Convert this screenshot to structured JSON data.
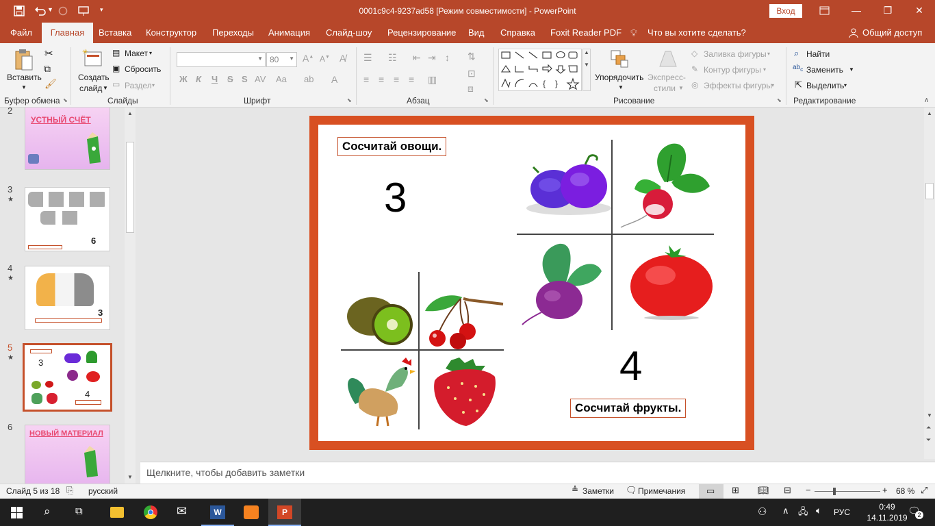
{
  "titlebar": {
    "title": "0001c9c4-9237ad58 [Режим совместимости]  -  PowerPoint",
    "signin": "Вход"
  },
  "tabs": [
    "Файл",
    "Главная",
    "Вставка",
    "Конструктор",
    "Переходы",
    "Анимация",
    "Слайд-шоу",
    "Рецензирование",
    "Вид",
    "Справка",
    "Foxit Reader PDF"
  ],
  "tell_me": "Что вы хотите сделать?",
  "share": "Общий доступ",
  "ribbon": {
    "clipboard": {
      "paste": "Вставить",
      "label": "Буфер обмена"
    },
    "slides": {
      "new_line1": "Создать",
      "new_line2": "слайд",
      "layout": "Макет",
      "reset": "Сбросить",
      "section": "Раздел",
      "label": "Слайды"
    },
    "font": {
      "size": "80",
      "bold": "Ж",
      "italic": "К",
      "underline": "Ч",
      "strike": "S",
      "label": "Шрифт"
    },
    "paragraph": {
      "label": "Абзац"
    },
    "drawing": {
      "arrange": "Упорядочить",
      "quick_line1": "Экспресс-",
      "quick_line2": "стили",
      "fill": "Заливка фигуры",
      "outline": "Контур фигуры",
      "effects": "Эффекты фигуры",
      "label": "Рисование"
    },
    "editing": {
      "find": "Найти",
      "replace": "Заменить",
      "select": "Выделить",
      "label": "Редактирование"
    }
  },
  "thumbnails": [
    {
      "num": "2",
      "star": "",
      "title": "УСТНЫЙ СЧЁТ"
    },
    {
      "num": "3",
      "star": "★",
      "count": "6"
    },
    {
      "num": "4",
      "star": "★",
      "count": "3"
    },
    {
      "num": "5",
      "star": "★",
      "count_top": "3",
      "count_bottom": "4",
      "selected": true
    },
    {
      "num": "6",
      "star": "",
      "title": "НОВЫЙ МАТЕРИАЛ"
    }
  ],
  "slide": {
    "caption_top": "Сосчитай овощи.",
    "number_top": "3",
    "number_bottom": "4",
    "caption_bottom": "Сосчитай фрукты."
  },
  "notes_placeholder": "Щелкните, чтобы добавить заметки",
  "status": {
    "slide_info": "Слайд 5 из 18",
    "language": "русский",
    "notes": "Заметки",
    "comments": "Примечания",
    "zoom": "68 %"
  },
  "taskbar": {
    "lang": "РУС",
    "time": "0:49",
    "date": "14.11.2019",
    "notif": "2"
  },
  "colors": {
    "accent": "#b7472a",
    "slide_border": "#d85022"
  }
}
